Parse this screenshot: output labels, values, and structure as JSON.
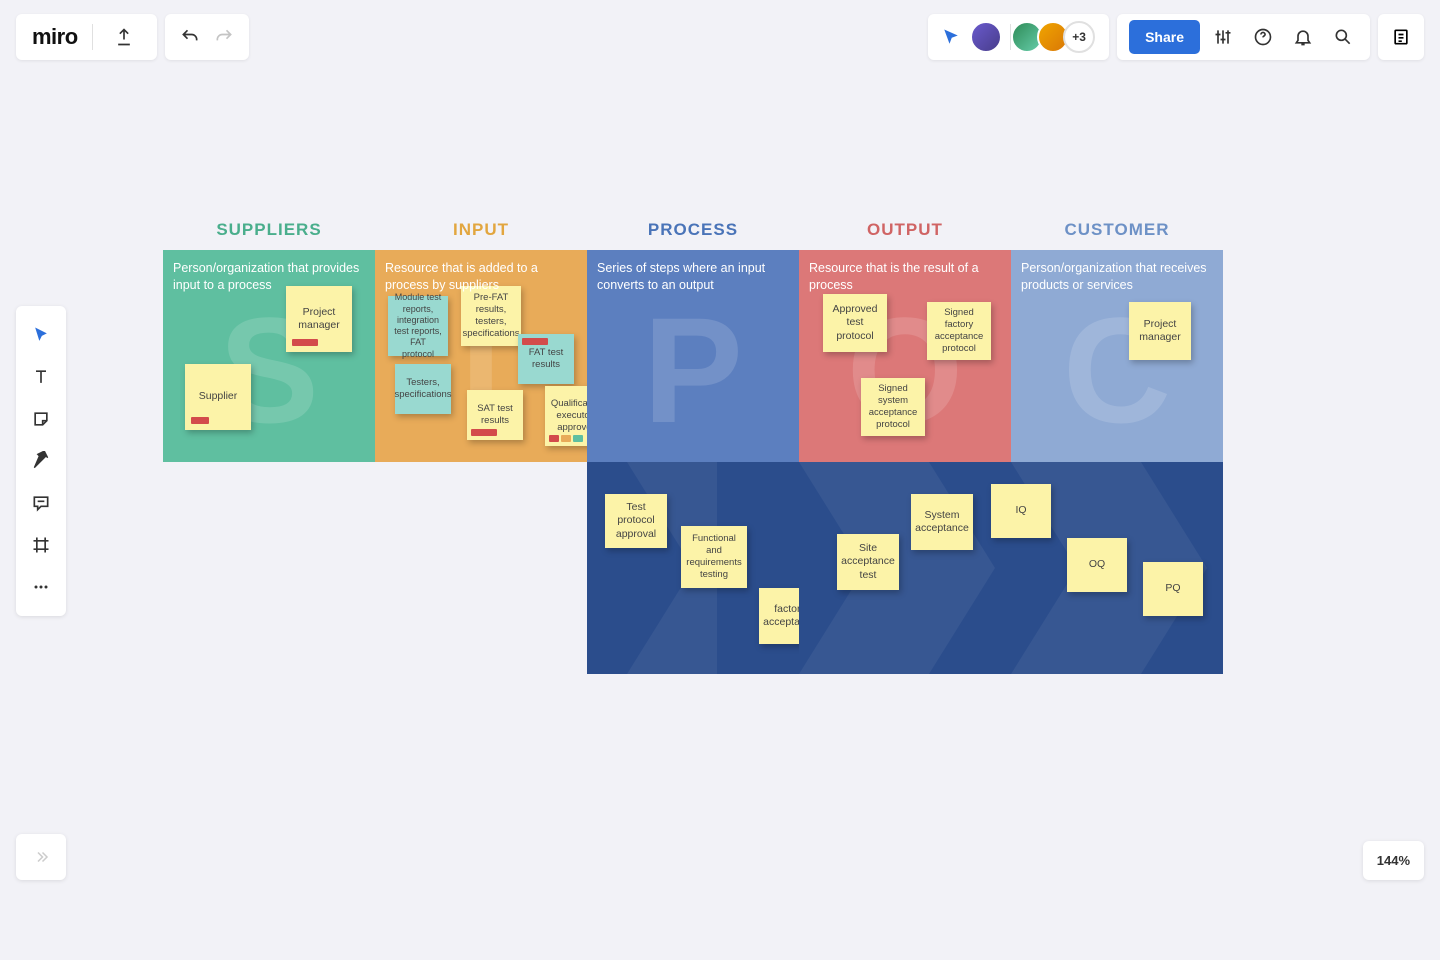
{
  "app": {
    "logo": "miro",
    "avatars_extra": "+3",
    "share": "Share",
    "zoom": "144%"
  },
  "sipoc": {
    "headers": {
      "s": "SUPPLIERS",
      "i": "INPUT",
      "p": "PROCESS",
      "o": "OUTPUT",
      "c": "CUSTOMER"
    },
    "descriptions": {
      "s": "Person/organization that provides input to a process",
      "i": "Resource that is added to a process by suppliers",
      "p": "Series of steps where an input converts to an output",
      "o": "Resource that is the result of a process",
      "c": "Person/organization that receives products or services"
    },
    "letters": {
      "s": "S",
      "i": "I",
      "p": "P",
      "o": "O",
      "c": "C"
    }
  },
  "stickies": {
    "suppliers": [
      {
        "text": "Project manager"
      },
      {
        "text": "Supplier"
      }
    ],
    "input": [
      {
        "text": "Module test reports, integration test reports, FAT protocol"
      },
      {
        "text": "Pre-FAT results, testers, specifications"
      },
      {
        "text": "Testers, specifications"
      },
      {
        "text": "FAT test results"
      },
      {
        "text": "SAT test results"
      },
      {
        "text": "Qualification executors approved"
      }
    ],
    "output": [
      {
        "text": "Approved test protocol"
      },
      {
        "text": "Signed factory acceptance protocol"
      },
      {
        "text": "Signed system acceptance protocol"
      }
    ],
    "customer": [
      {
        "text": "Project manager"
      }
    ],
    "process": [
      {
        "text": "Test protocol approval"
      },
      {
        "text": "Functional and requirements testing"
      },
      {
        "text": "factory acceptance"
      },
      {
        "text": "Site acceptance test"
      },
      {
        "text": "System acceptance"
      },
      {
        "text": "IQ"
      },
      {
        "text": "OQ"
      },
      {
        "text": "PQ"
      }
    ]
  }
}
